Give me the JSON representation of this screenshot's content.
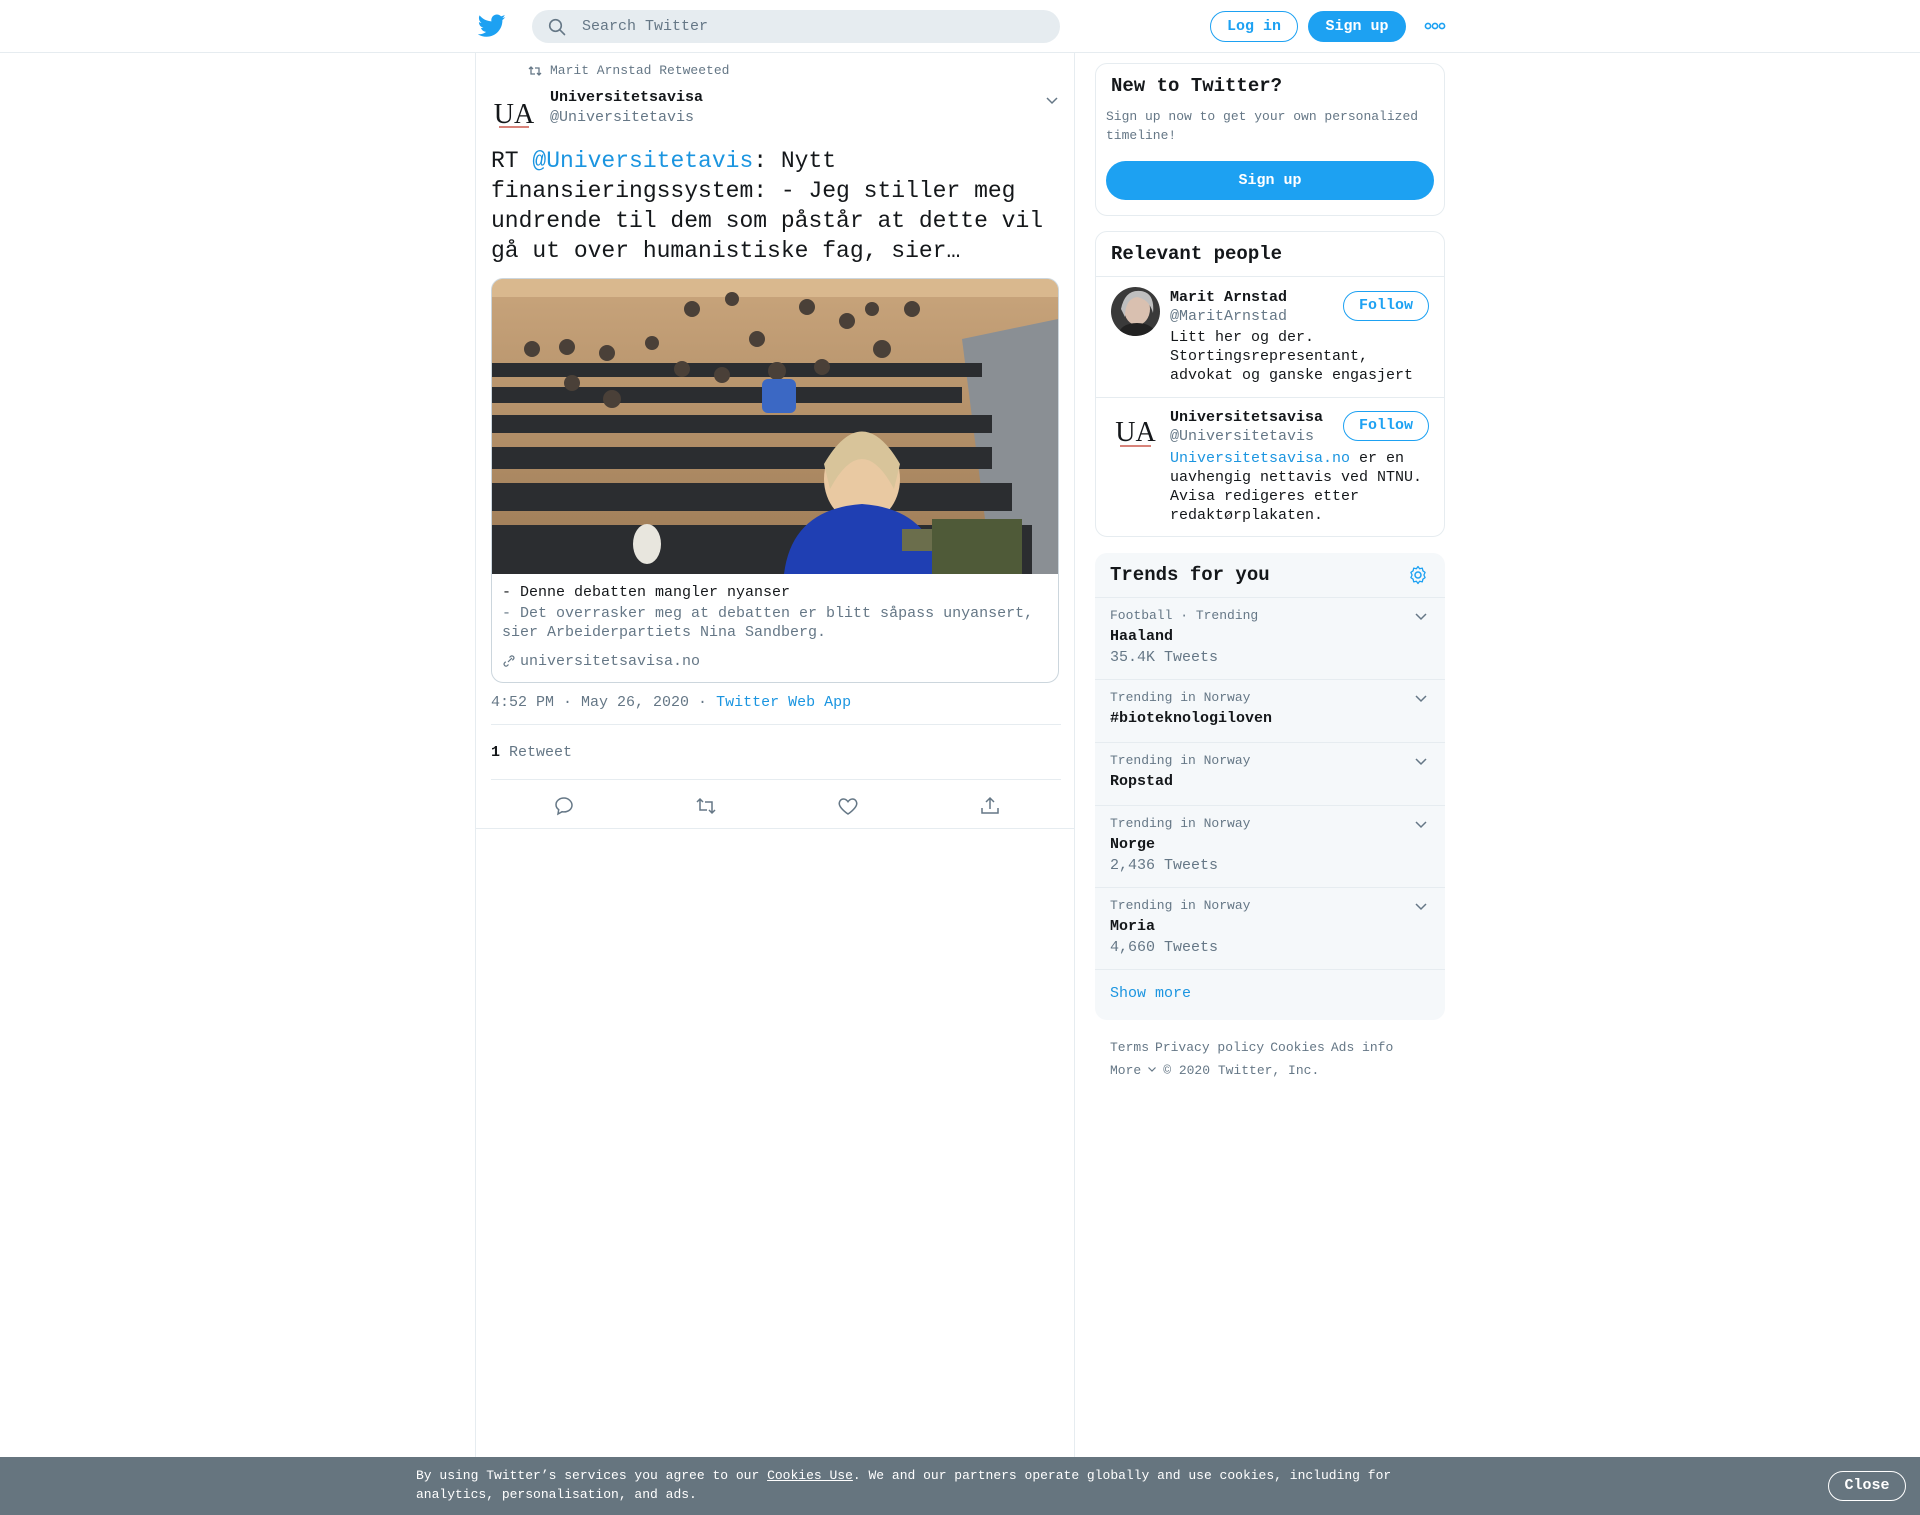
{
  "header": {
    "search_placeholder": "Search Twitter",
    "login_label": "Log in",
    "signup_label": "Sign up"
  },
  "tweet": {
    "retweeted_by": "Marit Arnstad Retweeted",
    "author_name": "Universitetsavisa",
    "author_handle": "@Universitetavis",
    "avatar_text": "UA",
    "text_prefix": "RT ",
    "text_mention": "@Universitetavis",
    "text_body": ": Nytt finansieringssystem: - Jeg stiller meg undrende til dem som påstår at dette vil gå ut over humanistiske fag, sier…",
    "card": {
      "title": "- Denne debatten mangler nyanser",
      "description": "- Det overrasker meg at debatten er blitt såpass unyansert, sier Arbeiderpartiets Nina Sandberg.",
      "domain": "universitetsavisa.no"
    },
    "timestamp": "4:52 PM · May 26, 2020",
    "separator": " · ",
    "source_app": "Twitter Web App",
    "retweet_count": "1",
    "retweet_label": "Retweet"
  },
  "new_to_twitter": {
    "title": "New to Twitter?",
    "description": "Sign up now to get your own personalized timeline!",
    "signup_label": "Sign up"
  },
  "relevant_people": {
    "title": "Relevant people",
    "people": [
      {
        "name": "Marit Arnstad",
        "handle": "@MaritArnstad",
        "follow_label": "Follow",
        "bio": "Litt her og der. Stortingsrepresentant, advokat og ganske engasjert"
      },
      {
        "name": "Universitetsavisa",
        "handle": "@Universitetavis",
        "follow_label": "Follow",
        "bio_link": "Universitetsavisa.no",
        "bio": " er en uavhengig nettavis ved NTNU. Avisa redigeres etter redaktørplakaten."
      }
    ]
  },
  "trends": {
    "title": "Trends for you",
    "items": [
      {
        "context": "Football · Trending",
        "name": "Haaland",
        "count": "35.4K Tweets"
      },
      {
        "context": "Trending in Norway",
        "name": "#bioteknologiloven",
        "count": ""
      },
      {
        "context": "Trending in Norway",
        "name": "Ropstad",
        "count": ""
      },
      {
        "context": "Trending in Norway",
        "name": "Norge",
        "count": "2,436 Tweets"
      },
      {
        "context": "Trending in Norway",
        "name": "Moria",
        "count": "4,660 Tweets"
      }
    ],
    "show_more": "Show more"
  },
  "footer": {
    "terms": "Terms",
    "privacy": "Privacy policy",
    "cookies": "Cookies",
    "ads": "Ads info",
    "more": "More",
    "copyright": "© 2020 Twitter, Inc."
  },
  "cookie_banner": {
    "text_before": "By using Twitter’s services you agree to our ",
    "link": "Cookies Use",
    "text_after": ". We and our partners operate globally and use cookies, including for analytics, personalisation, and ads.",
    "close_label": "Close"
  },
  "colors": {
    "brand": "#1da1f2",
    "link": "#1b95e0",
    "secondary_text": "#657786",
    "banner": "#66757f"
  }
}
